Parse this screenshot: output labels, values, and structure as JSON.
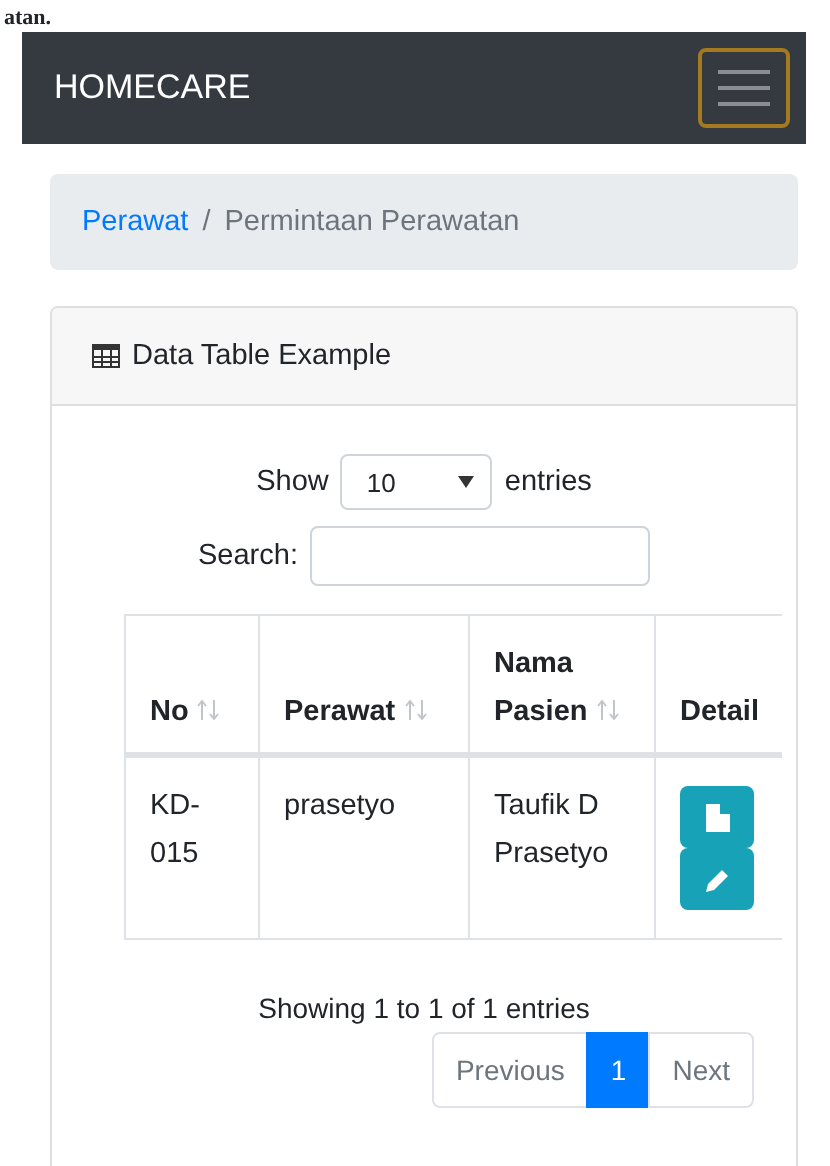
{
  "top_text": "atan.",
  "navbar": {
    "brand": "HOMECARE",
    "toggler_focused": true
  },
  "breadcrumb": {
    "separator": "/",
    "items": [
      {
        "label": "Perawat",
        "link": true
      },
      {
        "label": "Permintaan Perawatan",
        "link": false
      }
    ]
  },
  "card": {
    "title": "Data Table Example",
    "length": {
      "label_before": "Show",
      "value": "10",
      "label_after": "entries"
    },
    "search": {
      "label": "Search:"
    },
    "table": {
      "columns": [
        {
          "label": "No",
          "sortable": true
        },
        {
          "label": "Perawat",
          "sortable": true
        },
        {
          "label": "Nama Pasien",
          "sortable": true
        },
        {
          "label": "Detail",
          "sortable": false
        }
      ],
      "rows": [
        {
          "cells": [
            "KD-015",
            "prasetyo",
            "Taufik D Prasetyo"
          ]
        }
      ]
    },
    "info": "Showing 1 to 1 of 1 entries",
    "pagination": [
      {
        "label": "Previous",
        "selected": false,
        "disabled": true
      },
      {
        "label": "1",
        "selected": true,
        "disabled": false
      },
      {
        "label": "Next",
        "selected": false,
        "disabled": true
      }
    ]
  }
}
